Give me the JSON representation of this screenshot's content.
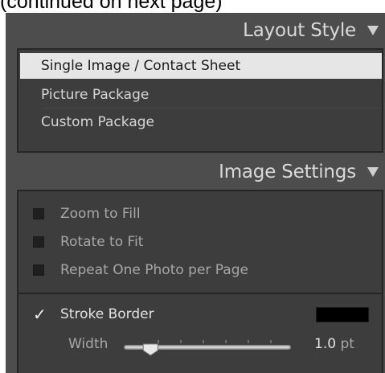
{
  "caption": "(continued on next page)",
  "layout_style": {
    "title": "Layout Style",
    "items": [
      {
        "label": "Single Image / Contact Sheet",
        "selected": true
      },
      {
        "label": "Picture Package",
        "selected": false
      },
      {
        "label": "Custom Package",
        "selected": false
      }
    ]
  },
  "image_settings": {
    "title": "Image Settings",
    "options": [
      {
        "label": "Zoom to Fill",
        "checked": false
      },
      {
        "label": "Rotate to Fit",
        "checked": false
      },
      {
        "label": "Repeat One Photo per Page",
        "checked": false
      }
    ],
    "stroke_border": {
      "label": "Stroke Border",
      "checked": true,
      "check_glyph": "✓",
      "color": "#000000",
      "width_label": "Width",
      "width_value": "1.0",
      "width_unit": "pt",
      "slider_level": 0.15
    }
  }
}
